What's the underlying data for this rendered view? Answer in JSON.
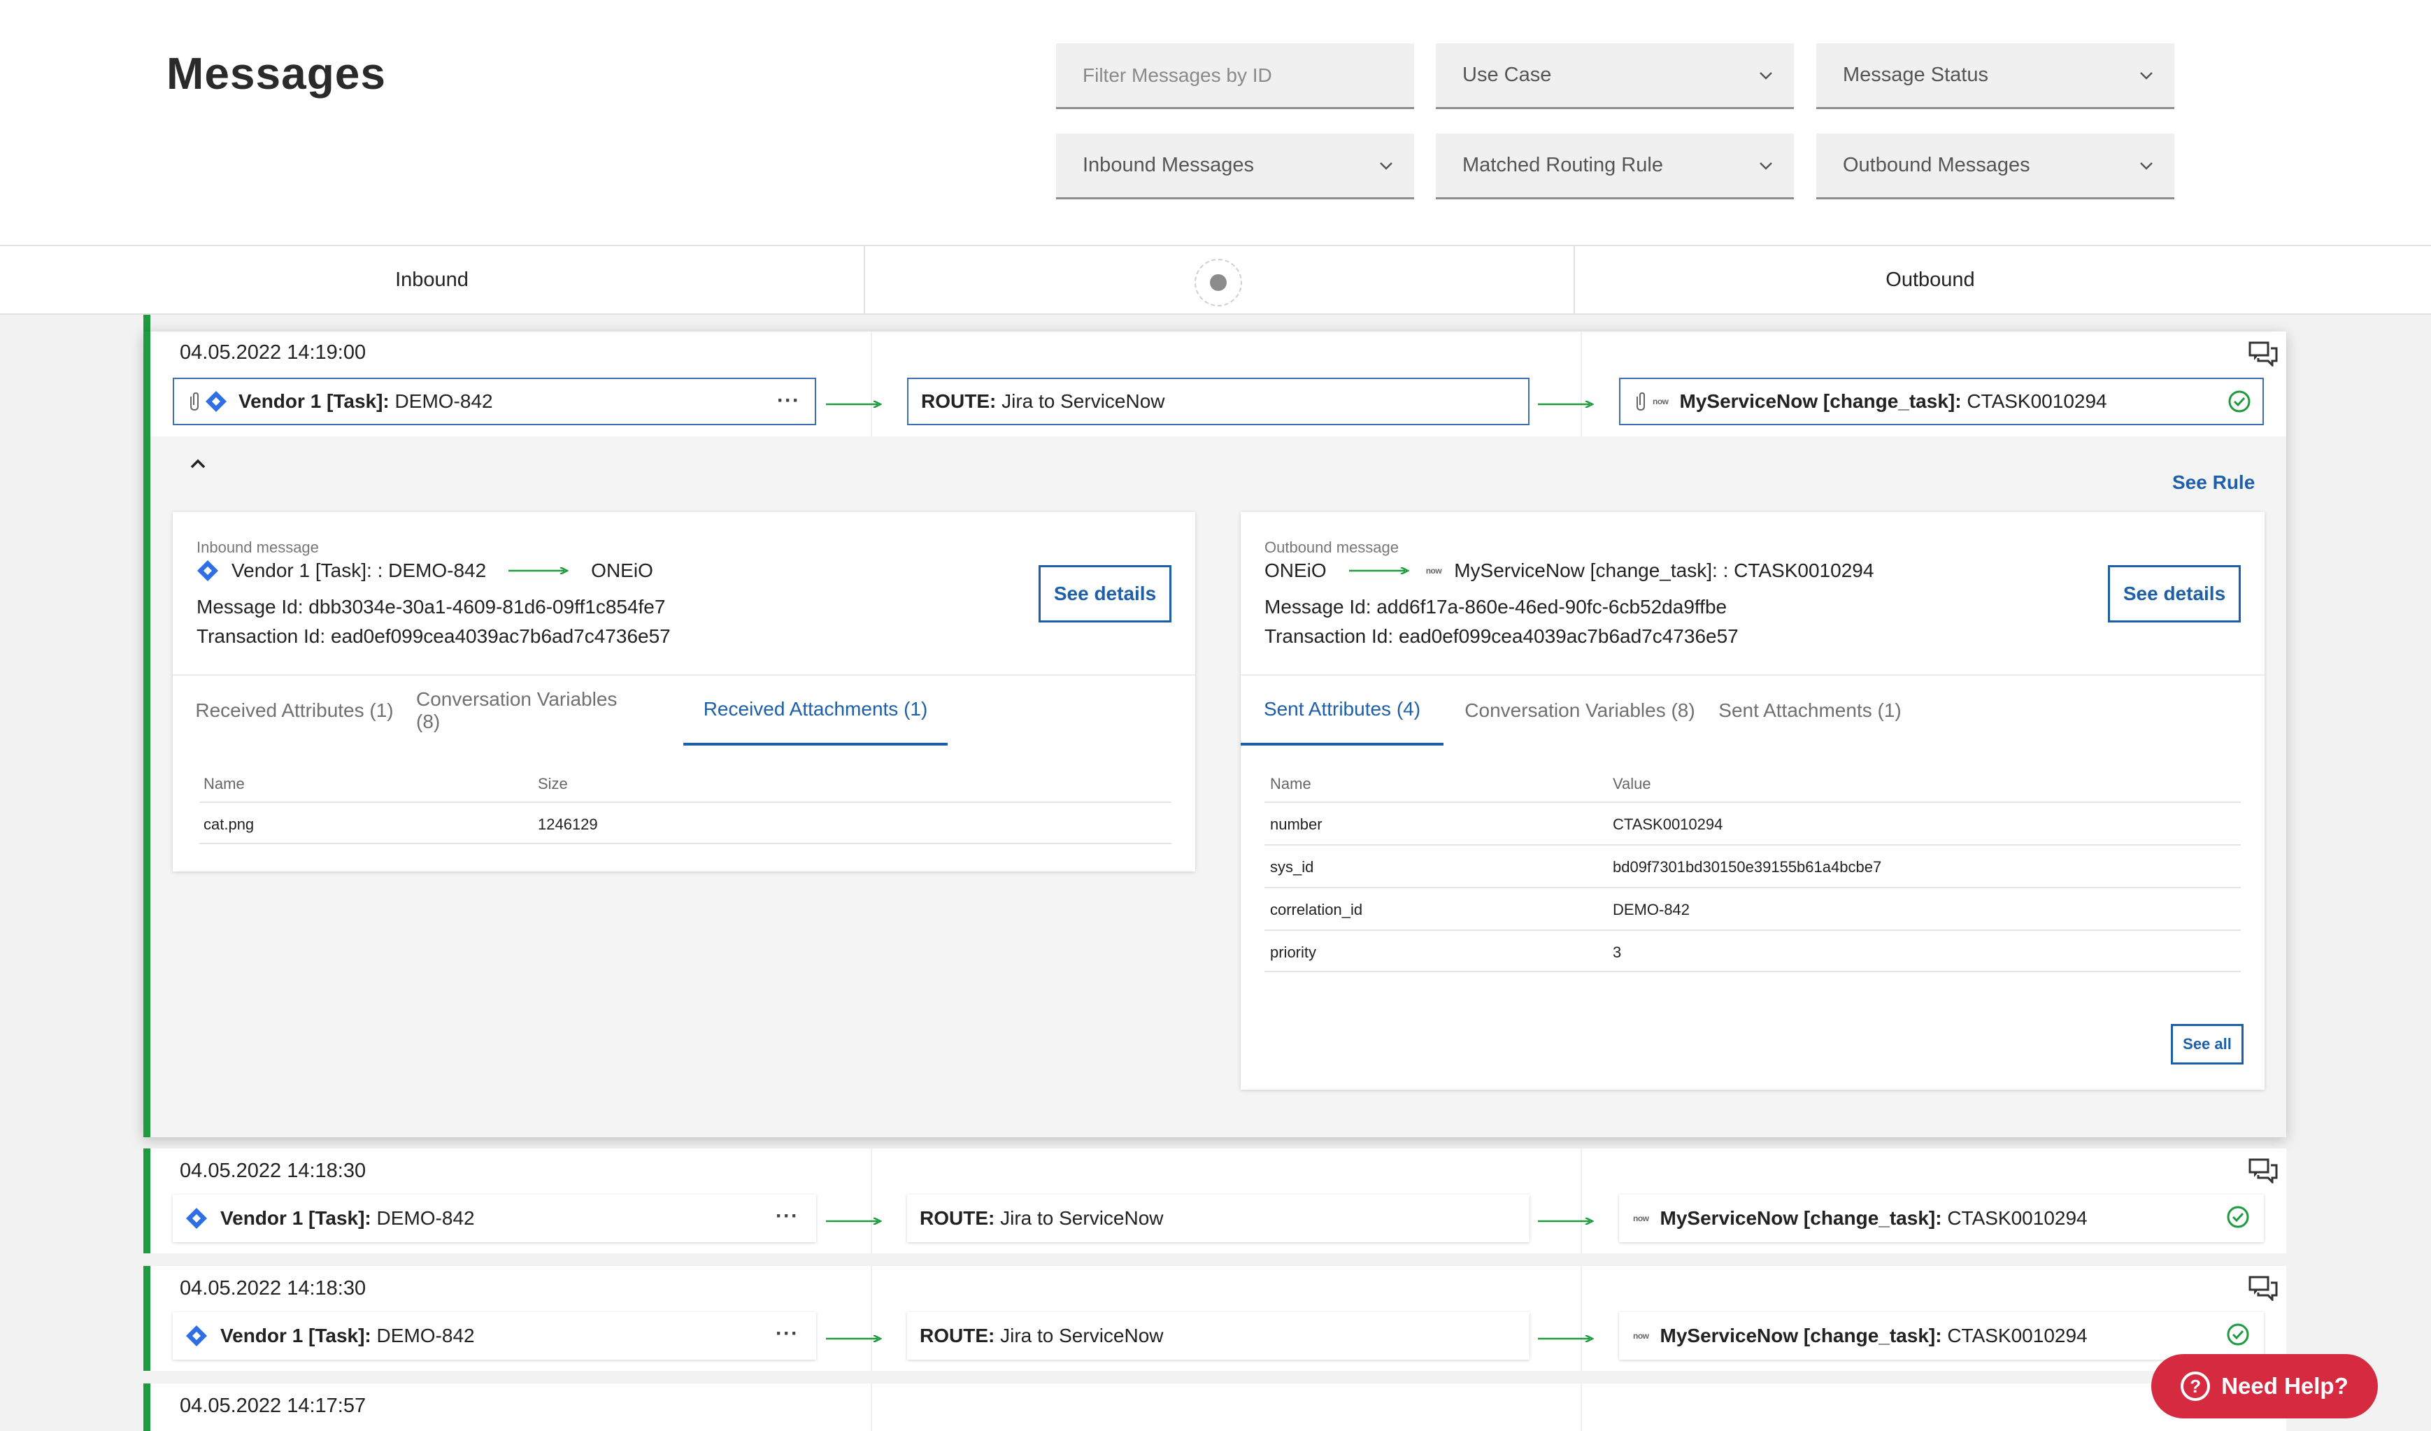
{
  "header": {
    "title": "Messages",
    "filters": {
      "id_placeholder": "Filter Messages by ID",
      "use_case": "Use Case",
      "message_status": "Message Status",
      "inbound_messages": "Inbound Messages",
      "matched_routing_rule": "Matched Routing Rule",
      "outbound_messages": "Outbound Messages"
    }
  },
  "columns": {
    "inbound": "Inbound",
    "outbound": "Outbound"
  },
  "icons": {
    "jira": "jira-diamond-icon",
    "servicenow": "servicenow-now-icon",
    "attachment": "paperclip-icon",
    "conversation": "conversation-bubbles-icon",
    "status": "check-circle-icon",
    "collapse": "chevron-up-icon",
    "more": "ellipsis-icon"
  },
  "colors": {
    "accent": "#1d5fa8",
    "success": "#1f9a3e",
    "help": "#d52a3f",
    "jira": "#2f6fe4"
  },
  "messages": [
    {
      "timestamp": "04.05.2022 14:19:00",
      "inbound_bold": "Vendor 1 [Task]:",
      "inbound_id": " DEMO-842",
      "route_bold": "ROUTE:",
      "route_name": " Jira to ServiceNow",
      "outbound_bold": "MyServiceNow [change_task]:",
      "outbound_id": " CTASK0010294",
      "expanded": true
    },
    {
      "timestamp": "04.05.2022 14:18:30",
      "inbound_bold": "Vendor 1 [Task]:",
      "inbound_id": " DEMO-842",
      "route_bold": "ROUTE:",
      "route_name": " Jira to ServiceNow",
      "outbound_bold": "MyServiceNow [change_task]:",
      "outbound_id": " CTASK0010294"
    },
    {
      "timestamp": "04.05.2022 14:18:30",
      "inbound_bold": "Vendor 1 [Task]:",
      "inbound_id": " DEMO-842",
      "route_bold": "ROUTE:",
      "route_name": " Jira to ServiceNow",
      "outbound_bold": "MyServiceNow [change_task]:",
      "outbound_id": " CTASK0010294"
    },
    {
      "timestamp": "04.05.2022 14:17:57"
    }
  ],
  "detail": {
    "see_rule": "See Rule",
    "inbound": {
      "label": "Inbound message",
      "source": "Vendor 1 [Task]: : DEMO-842",
      "target": "ONEiO",
      "message_id": "Message Id: dbb3034e-30a1-4609-81d6-09ff1c854fe7",
      "transaction_id": "Transaction Id: ead0ef099cea4039ac7b6ad7c4736e57",
      "see_details": "See details",
      "tabs": [
        "Received Attributes (1)",
        "Conversation Variables (8)",
        "Received Attachments (1)"
      ],
      "table": {
        "headers": [
          "Name",
          "Size"
        ],
        "rows": [
          [
            "cat.png",
            "1246129"
          ]
        ]
      }
    },
    "outbound": {
      "label": "Outbound message",
      "source": "ONEiO",
      "target": "MyServiceNow [change_task]: : CTASK0010294",
      "message_id": "Message Id: add6f17a-860e-46ed-90fc-6cb52da9ffbe",
      "transaction_id": "Transaction Id: ead0ef099cea4039ac7b6ad7c4736e57",
      "see_details": "See details",
      "tabs": [
        "Sent Attributes (4)",
        "Conversation Variables (8)",
        "Sent Attachments (1)"
      ],
      "table": {
        "headers": [
          "Name",
          "Value"
        ],
        "rows": [
          [
            "number",
            "CTASK0010294"
          ],
          [
            "sys_id",
            "bd09f7301bd30150e39155b61a4bcbe7"
          ],
          [
            "correlation_id",
            "DEMO-842"
          ],
          [
            "priority",
            "3"
          ]
        ]
      },
      "see_all": "See all"
    }
  },
  "help_button": "Need Help?"
}
